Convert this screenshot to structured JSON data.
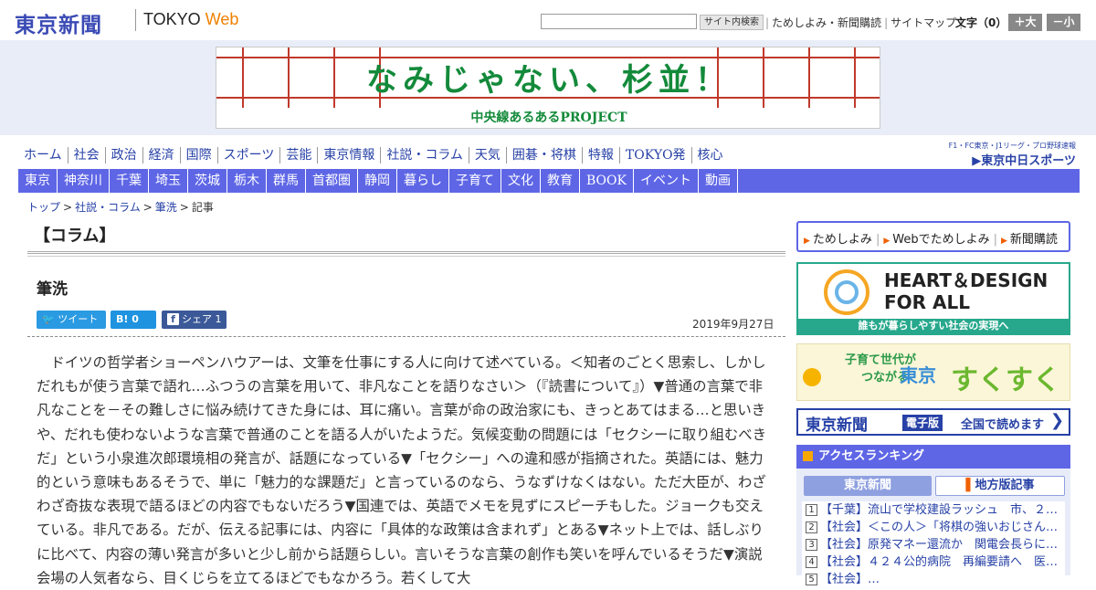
{
  "header": {
    "logo": "東京新聞",
    "logo_tokyo": "TOKYO",
    "logo_web": "Web",
    "search_placeholder": "",
    "search_button": "サイト内検索",
    "links": [
      "ためしよみ・新聞購読",
      "サイトマップ"
    ],
    "font_size_label": "文字（0）",
    "font_plus": "＋大",
    "font_minus": "－小"
  },
  "banner": {
    "title": "なみじゃない、杉並！",
    "subtitle": "中央線あるあるPROJECT"
  },
  "nav_main": [
    "ホーム",
    "社会",
    "政治",
    "経済",
    "国際",
    "スポーツ",
    "芸能",
    "東京情報",
    "社説・コラム",
    "天気",
    "囲碁・将棋",
    "特報",
    "TOKYO発",
    "核心"
  ],
  "chunichi": {
    "caption": "F1・FC東京・J1リーグ・プロ野球速報",
    "logo": "▶東京中日スポーツ"
  },
  "nav_regional": [
    "東京",
    "神奈川",
    "千葉",
    "埼玉",
    "茨城",
    "栃木",
    "群馬",
    "首都圏",
    "静岡",
    "暮らし",
    "子育て",
    "文化",
    "教育",
    "BOOK",
    "イベント",
    "動画"
  ],
  "breadcrumb": {
    "items": [
      "トップ",
      "社説・コラム",
      "筆洗"
    ],
    "current": "記事"
  },
  "article": {
    "section": "【コラム】",
    "title": "筆洗",
    "tweet": "ツイート",
    "hatena": "B! 0",
    "facebook": "シェア 1",
    "date": "2019年9月27日",
    "body": "ドイツの哲学者ショーペンハウアーは、文筆を仕事にする人に向けて述べている。＜知者のごとく思索し、しかしだれもが使う言葉で語れ…ふつうの言葉を用いて、非凡なことを語りなさい＞（『読書について』）▼普通の言葉で非凡なことを－その難しさに悩み続けてきた身には、耳に痛い。言葉が命の政治家にも、きっとあてはまる…と思いきや、だれも使わないような言葉で普通のことを語る人がいたようだ。気候変動の問題には「セクシーに取り組むべきだ」という小泉進次郎環境相の発言が、話題になっている▼「セクシー」への違和感が指摘された。英語には、魅力的という意味もあるそうで、単に「魅力的な課題だ」と言っているのなら、うなずけなくはない。ただ大臣が、わざわざ奇抜な表現で語るほどの内容でもないだろう▼国連では、英語でメモを見ずにスピーチもした。ジョークも交えている。非凡である。だが、伝える記事には、内容に「具体的な政策は含まれず」とある▼ネット上では、話しぶりに比べて、内容の薄い発言が多いと少し前から話題らしい。言いそうな言葉の創作も笑いを呼んでいるそうだ▼演説会場の人気者なら、目くじらを立てるほどでもなかろう。若くして大"
  },
  "sidebar": {
    "links": [
      "ためしよみ",
      "Webでためしよみ",
      "新聞購読"
    ],
    "hd_title_1": "HEART＆DESIGN",
    "hd_title_2": "FOR ALL",
    "hd_caption": "誰もが暮らしやすい社会の実現へ",
    "sk_1": "子育て世代が",
    "sk_1b": "つながる",
    "sk_2": "東京",
    "sk_3": "すくすく",
    "ed_1": "東京新聞",
    "ed_2": "電子版",
    "ed_3": "全国で読めます",
    "ed_arrow": "❯",
    "ranking_title": "アクセスランキング",
    "tab_1": "東京新聞",
    "tab_2": "地方版記事",
    "ranking": [
      {
        "num": "1",
        "text": "【千葉】流山で学校建設ラッシュ　市、２…"
      },
      {
        "num": "2",
        "text": "【社会】＜この人＞「将棋の強いおじさん…"
      },
      {
        "num": "3",
        "text": "【社会】原発マネー還流か　関電会長らに…"
      },
      {
        "num": "4",
        "text": "【社会】４２４公的病院　再編要請へ　医…"
      },
      {
        "num": "5",
        "text": "【社会】…"
      }
    ]
  }
}
